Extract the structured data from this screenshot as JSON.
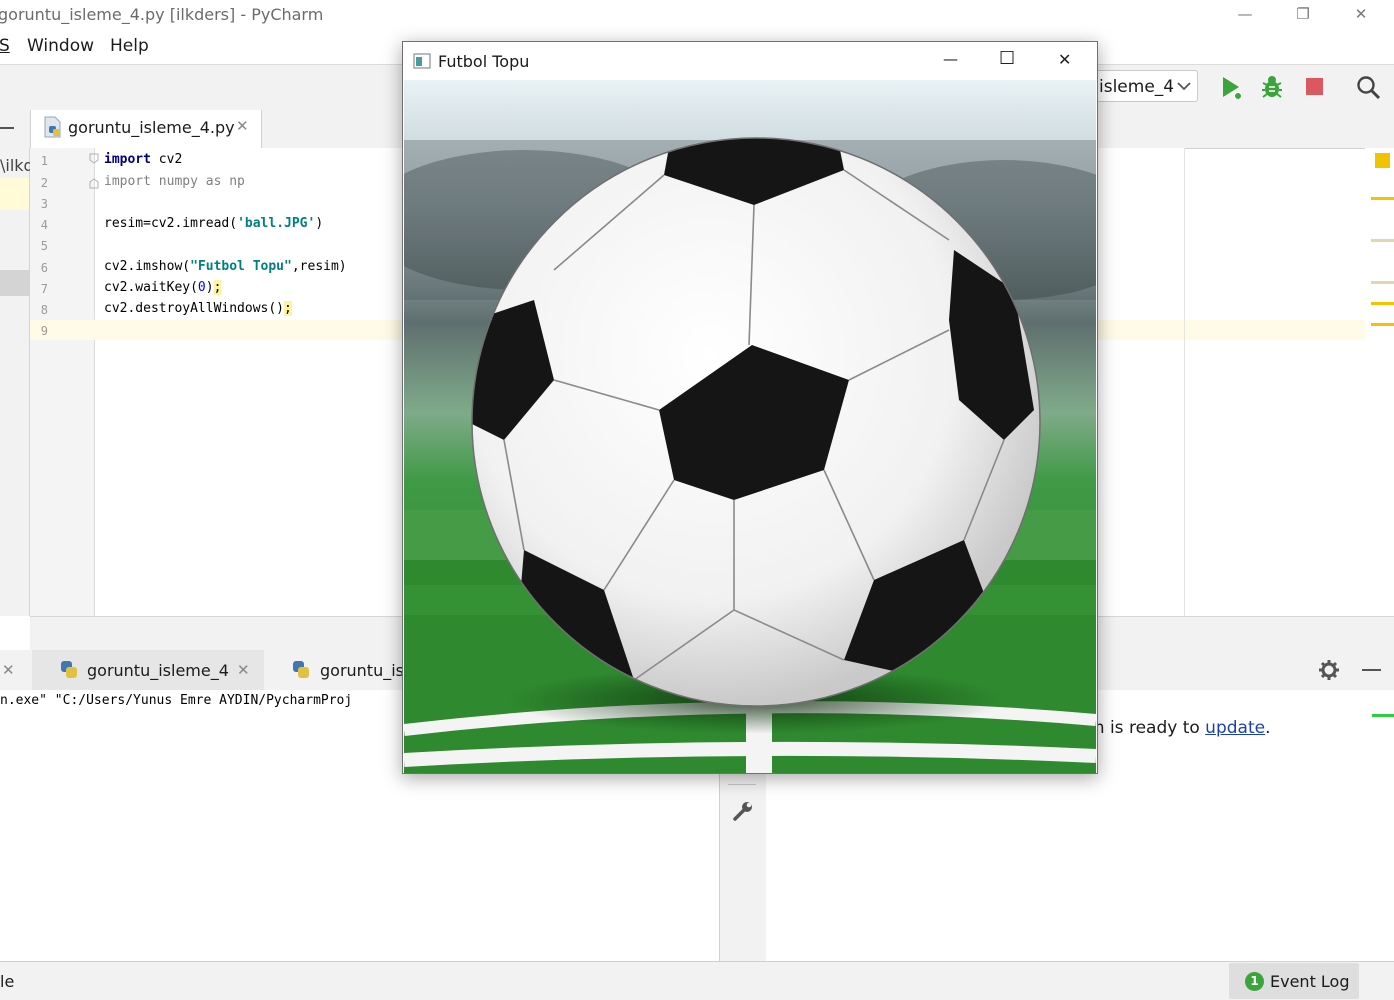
{
  "ide": {
    "title": "goruntu_isleme_4.py [ilkders] - PyCharm",
    "window_buttons": {
      "minimize": "—",
      "restore": "❐",
      "close": "✕"
    },
    "menu": [
      {
        "label": "S"
      },
      {
        "label": "Window"
      },
      {
        "label": "Help"
      }
    ],
    "run_config": {
      "label": "isleme_4"
    },
    "editor_tab": {
      "label": "goruntu_isleme_4.py"
    },
    "project_fragment": "\\ilkd",
    "line_numbers": [
      "1",
      "2",
      "3",
      "4",
      "5",
      "6",
      "7",
      "8",
      "9"
    ],
    "code": {
      "l1_kw": "import",
      "l1_rest": " cv2",
      "l2": "import numpy as np",
      "l4_a": "resim=cv2.imread(",
      "l4_str": "'ball.JPG'",
      "l4_b": ")",
      "l6_a": "cv2.imshow(",
      "l6_str": "\"Futbol Topu\"",
      "l6_b": ",resim)",
      "l7_a": "cv2.waitKey(",
      "l7_num": "0",
      "l7_b": ")",
      "l7_semi": ";",
      "l8_a": "cv2.destroyAllWindows()",
      "l8_semi": ";"
    },
    "run_panel": {
      "tabs": [
        {
          "label": "goruntu_isleme_4"
        },
        {
          "label": "goruntu_is"
        }
      ],
      "command": "n.exe\" \"C:/Users/Yunus Emre AYDIN/PycharmProj",
      "event_message_prefix": "m is ready to ",
      "event_link": "update",
      "event_suffix": "."
    },
    "status": {
      "left_text": "le",
      "event_log_count": "1",
      "event_log_label": "Event Log"
    }
  },
  "cv_window": {
    "title": "Futbol Topu",
    "buttons": {
      "minimize": "—",
      "maximize": "☐",
      "close": "✕"
    }
  },
  "colors": {
    "run_green": "#3ba53b",
    "stop_red": "#db5860",
    "warning_yellow": "#f0c400",
    "grass_green": "#2f8a2f",
    "link_blue": "#1a3fb8"
  }
}
